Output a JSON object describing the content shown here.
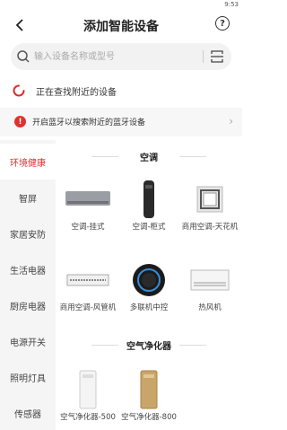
{
  "status_bar": {
    "time": "9:53"
  },
  "header": {
    "title": "添加智能设备",
    "help_icon_text": "?"
  },
  "search": {
    "placeholder": "输入设备名称或型号"
  },
  "searching": {
    "text": "正在查找附近的设备"
  },
  "bluetooth_notice": {
    "icon_text": "!",
    "text": "开启蓝牙以搜索附近的蓝牙设备",
    "chevron": "›"
  },
  "sidebar": {
    "items": [
      {
        "label": "环境健康",
        "active": true
      },
      {
        "label": "智屏",
        "active": false
      },
      {
        "label": "家居安防",
        "active": false
      },
      {
        "label": "生活电器",
        "active": false
      },
      {
        "label": "厨房电器",
        "active": false
      },
      {
        "label": "电源开关",
        "active": false
      },
      {
        "label": "照明灯具",
        "active": false
      },
      {
        "label": "传感器",
        "active": false
      }
    ]
  },
  "sections": [
    {
      "title": "空调",
      "devices": [
        {
          "label": "空调-挂式",
          "icon": "wall-ac-icon"
        },
        {
          "label": "空调-柜式",
          "icon": "floor-ac-icon"
        },
        {
          "label": "商用空调-天花机",
          "icon": "ceiling-ac-icon"
        },
        {
          "label": "商用空调-风管机",
          "icon": "duct-ac-icon"
        },
        {
          "label": "多联机中控",
          "icon": "central-controller-icon"
        },
        {
          "label": "热风机",
          "icon": "heater-icon"
        }
      ]
    },
    {
      "title": "空气净化器",
      "devices": [
        {
          "label": "空气净化器-500",
          "icon": "purifier-500-icon"
        },
        {
          "label": "空气净化器-800",
          "icon": "purifier-800-icon"
        }
      ]
    }
  ],
  "colors": {
    "accent": "#e02d2d",
    "sidebar_bg": "#f5f5f5",
    "notice_bg": "#f7f7f7"
  }
}
